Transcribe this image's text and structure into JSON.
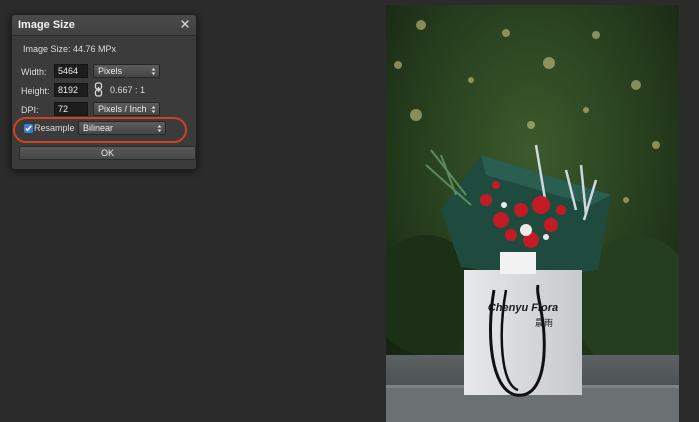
{
  "dialog": {
    "title": "Image Size",
    "close_icon": "close-icon",
    "image_size_label": "Image Size: 44.76 MPx",
    "width": {
      "label": "Width:",
      "value": "5464",
      "unit": "Pixels"
    },
    "height": {
      "label": "Height:",
      "value": "8192",
      "ratio": "0.667 : 1"
    },
    "dpi": {
      "label": "DPI:",
      "value": "72",
      "unit": "Pixels / Inch"
    },
    "resample": {
      "checked": true,
      "label": "Resample",
      "method": "Bilinear"
    },
    "ok_label": "OK"
  },
  "photo": {
    "brand_text": "Chenyu Flora",
    "brand_text_cn": "晨雨"
  },
  "colors": {
    "background": "#2b2b2b",
    "dialog": "#3b3b3b",
    "highlight": "#d0421b",
    "bag_green": "#1f4b3f",
    "flowers_red": "#c41a24"
  }
}
